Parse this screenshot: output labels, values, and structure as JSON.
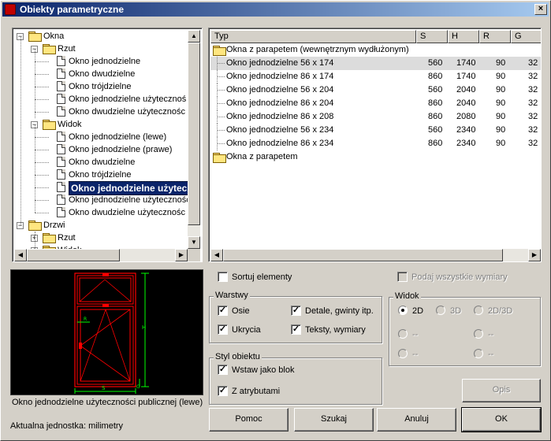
{
  "window": {
    "title": "Obiekty parametryczne",
    "close": "×"
  },
  "tree": {
    "nodes": [
      {
        "label": "Okna"
      },
      {
        "label": "Rzut"
      },
      {
        "label": "Okno jednodzielne"
      },
      {
        "label": "Okno dwudzielne"
      },
      {
        "label": "Okno trójdzielne"
      },
      {
        "label": "Okno jednodzielne użytecznoś"
      },
      {
        "label": "Okno dwudzielne użytecznośc"
      },
      {
        "label": "Widok"
      },
      {
        "label": "Okno jednodzielne (lewe)"
      },
      {
        "label": "Okno jednodzielne (prawe)"
      },
      {
        "label": "Okno dwudzielne"
      },
      {
        "label": "Okno trójdzielne"
      },
      {
        "label": "Okno jednodzielne użytecz"
      },
      {
        "label": "Okno jednodzielne użytecznośc"
      },
      {
        "label": "Okno dwudzielne użytecznośc"
      },
      {
        "label": "Drzwi"
      },
      {
        "label": "Rzut"
      },
      {
        "label": "Widok"
      }
    ]
  },
  "list": {
    "headers": [
      "Typ",
      "S",
      "H",
      "R",
      "G"
    ],
    "groups": [
      {
        "label": "Okna z parapetem (wewnętrznym wydłużonym)"
      },
      {
        "label": "Okna z parapetem"
      }
    ],
    "rows": [
      {
        "name": "Okno jednodzielne 56 x 174",
        "S": "560",
        "H": "1740",
        "R": "90",
        "G": "32"
      },
      {
        "name": "Okno jednodzielne 86 x 174",
        "S": "860",
        "H": "1740",
        "R": "90",
        "G": "32"
      },
      {
        "name": "Okno jednodzielne 56 x 204",
        "S": "560",
        "H": "2040",
        "R": "90",
        "G": "32"
      },
      {
        "name": "Okno jednodzielne 86 x 204",
        "S": "860",
        "H": "2040",
        "R": "90",
        "G": "32"
      },
      {
        "name": "Okno jednodzielne 86 x 208",
        "S": "860",
        "H": "2080",
        "R": "90",
        "G": "32"
      },
      {
        "name": "Okno jednodzielne 56 x 234",
        "S": "560",
        "H": "2340",
        "R": "90",
        "G": "32"
      },
      {
        "name": "Okno jednodzielne 86 x 234",
        "S": "860",
        "H": "2340",
        "R": "90",
        "G": "32"
      }
    ]
  },
  "preview": {
    "caption": "Okno jednodzielne użyteczności publicznej (lewe)",
    "dim_h": "H",
    "dim_s": "S",
    "dim_r": "R",
    "dim_g": "G"
  },
  "status": "Aktualna jednostka: milimetry",
  "options": {
    "sort_label": "Sortuj elementy",
    "all_dims_label": "Podaj wszystkie wymiary"
  },
  "layers": {
    "legend": "Warstwy",
    "osie": "Osie",
    "detale": "Detale, gwinty itp.",
    "ukrycia": "Ukrycia",
    "teksty": "Teksty, wymiary"
  },
  "style": {
    "legend": "Styl obiektu",
    "block": "Wstaw jako blok",
    "attrs": "Z atrybutami"
  },
  "view": {
    "legend": "Widok",
    "opt_2d": "2D",
    "opt_3d": "3D",
    "opt_2d3d": "2D/3D",
    "dash": "--"
  },
  "buttons": {
    "opis": "Opis",
    "pomoc": "Pomoc",
    "szukaj": "Szukaj",
    "anuluj": "Anuluj",
    "ok": "OK"
  },
  "colors": {
    "titlebar": "#0a246a",
    "selection": "#0a246a",
    "cad_red": "#ff0000",
    "cad_green": "#00ff00",
    "cad_bg": "#000000"
  }
}
